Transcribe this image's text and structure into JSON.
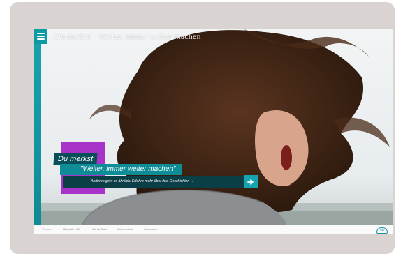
{
  "header": {
    "menu_icon": "hamburger-menu-icon",
    "title": "Du merkst · Weiter, immer weiter machen"
  },
  "hero": {
    "label": "Du merkst",
    "quote": "\"Weiter, immer weiter machen\"",
    "cta_text": "Anderen geht es ähnlich. Erfahre mehr über ihre Geschichten …",
    "cta_icon": "arrow-right-icon",
    "colors": {
      "teal": "#0e8d97",
      "dark_teal": "#0b3f48",
      "purple": "#a933c9"
    }
  },
  "footer": {
    "links": [
      "Themen",
      "Hilfeseite Hilfe",
      "Hilfe ist Spiel",
      "Datenschutz",
      "Impressum"
    ],
    "logo_text": "dak"
  }
}
